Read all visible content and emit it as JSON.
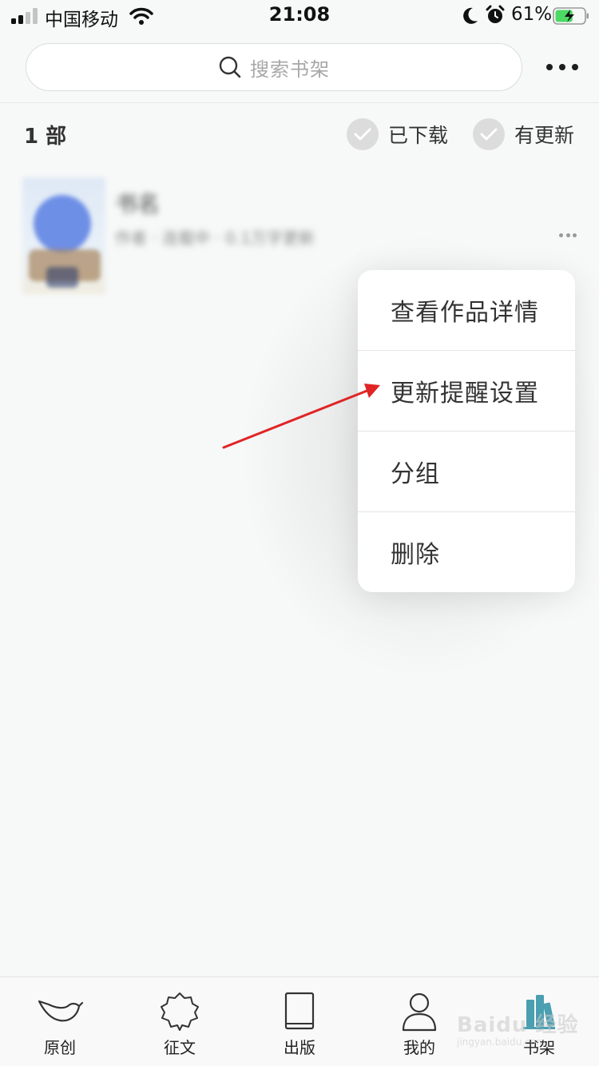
{
  "status_bar": {
    "carrier": "中国移动",
    "time": "21:08",
    "battery_percent": "61%",
    "battery_level": 0.61,
    "icons": [
      "signal-icon",
      "wifi-icon",
      "moon-icon",
      "alarm-icon",
      "battery-charging-icon"
    ]
  },
  "header": {
    "search_placeholder": "搜索书架",
    "search_icon": "search-icon",
    "more_icon": "more-horizontal-icon"
  },
  "filters": {
    "count": "1 部",
    "downloaded_label": "已下载",
    "updated_label": "有更新"
  },
  "book": {
    "title": "书名",
    "meta": "作者 · 连载中 · 0.1万字更新"
  },
  "menu": {
    "items": [
      {
        "label": "查看作品详情"
      },
      {
        "label": "更新提醒设置"
      },
      {
        "label": "分组"
      },
      {
        "label": "删除"
      }
    ]
  },
  "tab_bar": {
    "tabs": [
      {
        "label": "原创",
        "icon": "bird-icon"
      },
      {
        "label": "征文",
        "icon": "badge-icon"
      },
      {
        "label": "出版",
        "icon": "book-icon"
      },
      {
        "label": "我的",
        "icon": "user-icon"
      },
      {
        "label": "书架",
        "icon": "bookshelf-icon",
        "active": true
      }
    ]
  },
  "colors": {
    "active_tab": "#4a9fb0",
    "annotation_arrow": "#e02424"
  }
}
